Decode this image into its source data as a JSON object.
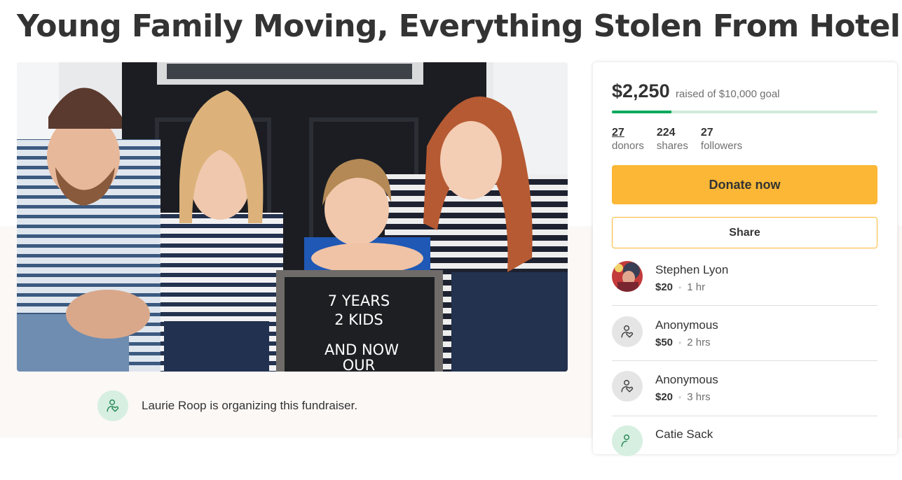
{
  "page": {
    "title": "Young Family Moving, Everything Stolen From Hotel"
  },
  "photo": {
    "sign_lines": [
      "7 YEARS",
      "2 KIDS",
      "AND NOW",
      "OUR"
    ]
  },
  "organizer": {
    "text": "Laurie Roop is organizing this fundraiser."
  },
  "campaign": {
    "raised": "$2,250",
    "goal_text": "raised of $10,000 goal",
    "progress_fraction": 0.225,
    "stats": [
      {
        "value": "27",
        "label": "donors"
      },
      {
        "value": "224",
        "label": "shares"
      },
      {
        "value": "27",
        "label": "followers"
      }
    ],
    "donate_label": "Donate now",
    "share_label": "Share"
  },
  "donations": [
    {
      "name": "Stephen Lyon",
      "amount": "$20",
      "time": "1 hr"
    },
    {
      "name": "Anonymous",
      "amount": "$50",
      "time": "2 hrs"
    },
    {
      "name": "Anonymous",
      "amount": "$20",
      "time": "3 hrs"
    },
    {
      "name": "Catie Sack"
    }
  ],
  "colors": {
    "accent_green": "#02a95c",
    "donate_yellow": "#fbb735"
  },
  "icons": {
    "organizer": "heart-person-icon",
    "anonymous": "heart-person-icon"
  }
}
